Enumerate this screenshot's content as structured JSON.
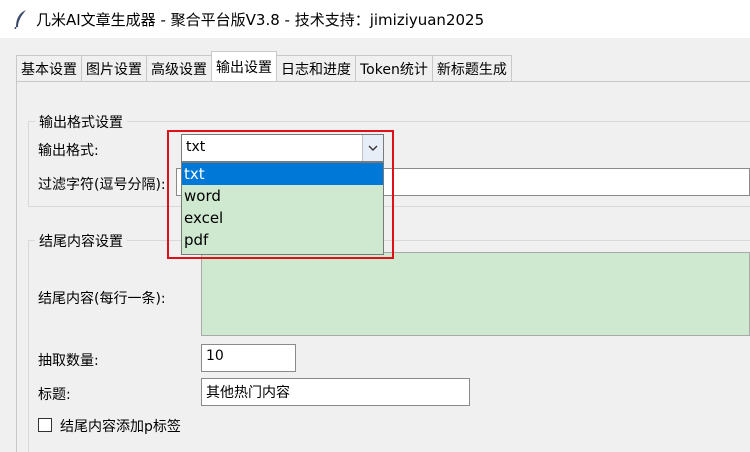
{
  "window": {
    "title": "几米AI文章生成器 - 聚合平台版V3.8 - 技术支持：jimiziyuan2025"
  },
  "tabs": [
    {
      "label": "基本设置"
    },
    {
      "label": "图片设置"
    },
    {
      "label": "高级设置"
    },
    {
      "label": "输出设置",
      "active": true
    },
    {
      "label": "日志和进度"
    },
    {
      "label": "Token统计"
    },
    {
      "label": "新标题生成"
    }
  ],
  "output_format": {
    "section_title": "输出格式设置",
    "format_label": "输出格式:",
    "format_value": "txt",
    "filter_label": "过滤字符(逗号分隔):",
    "options": [
      "txt",
      "word",
      "excel",
      "pdf"
    ],
    "selected": "txt"
  },
  "ending": {
    "section_title": "结尾内容设置",
    "content_label": "结尾内容(每行一条):",
    "count_label": "抽取数量:",
    "count_value": "10",
    "title_label": "标题:",
    "title_value": "其他热门内容",
    "checkbox_label": "结尾内容添加p标签"
  },
  "colors": {
    "accent": "#0078d7",
    "highlight": "#e0101a",
    "field_green": "#cfe8d0"
  }
}
